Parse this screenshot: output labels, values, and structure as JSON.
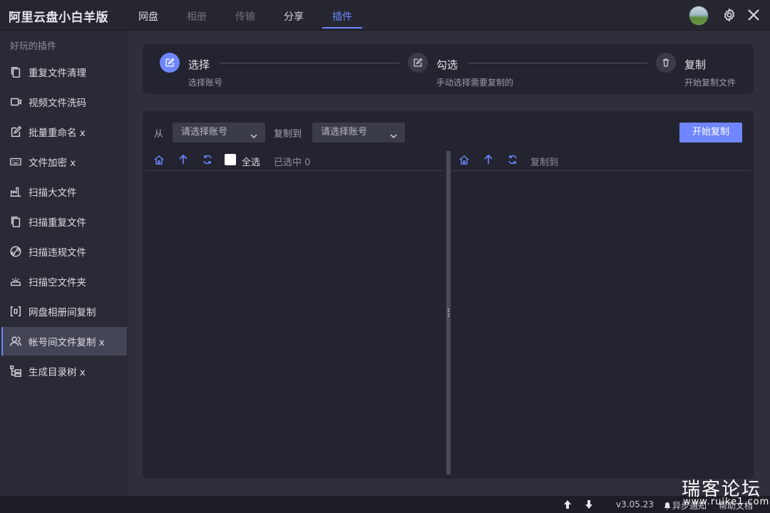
{
  "app": {
    "title": "阿里云盘小白羊版"
  },
  "nav": {
    "tabs": [
      {
        "label": "网盘",
        "state": "normal"
      },
      {
        "label": "相册",
        "state": "dim"
      },
      {
        "label": "传输",
        "state": "dim"
      },
      {
        "label": "分享",
        "state": "normal"
      },
      {
        "label": "插件",
        "state": "active"
      }
    ],
    "icons": [
      "avatar",
      "gear-icon",
      "close-icon"
    ]
  },
  "sidebar": {
    "heading": "好玩的插件",
    "items": [
      {
        "label": "重复文件清理",
        "icon": "duplicate-file-icon"
      },
      {
        "label": "视频文件洗码",
        "icon": "video-icon"
      },
      {
        "label": "批量重命名 x",
        "icon": "rename-icon"
      },
      {
        "label": "文件加密 x",
        "icon": "keyboard-icon"
      },
      {
        "label": "扫描大文件",
        "icon": "factory-icon"
      },
      {
        "label": "扫描重复文件",
        "icon": "copy-icon"
      },
      {
        "label": "扫描违规文件",
        "icon": "link-icon"
      },
      {
        "label": "扫描空文件夹",
        "icon": "sun-cloud-icon"
      },
      {
        "label": "网盘相册间复制",
        "icon": "bracket-icon"
      },
      {
        "label": "帐号间文件复制 x",
        "icon": "users-icon",
        "active": true
      },
      {
        "label": "生成目录树 x",
        "icon": "tree-icon"
      }
    ]
  },
  "steps": [
    {
      "title": "选择",
      "desc": "选择账号",
      "icon": "edit-icon",
      "active": true
    },
    {
      "title": "勾选",
      "desc": "手动选择需要复制的",
      "icon": "edit-icon",
      "active": false
    },
    {
      "title": "复制",
      "desc": "开始复制文件",
      "icon": "trash-icon",
      "active": false
    }
  ],
  "copy_panel": {
    "from_label": "从",
    "from_placeholder": "请选择账号",
    "to_label": "复制到",
    "to_placeholder": "请选择账号",
    "start_button": "开始复制",
    "left_toolbar": {
      "select_all": "全选",
      "selected_count": "已选中 0"
    },
    "right_toolbar": {
      "dest_label": "复制到"
    }
  },
  "statusbar": {
    "version": "v3.05.23",
    "notice": "异步通知",
    "help": "帮助文档"
  },
  "watermark": {
    "text": "瑞客论坛",
    "url": "www.ruike1.com"
  },
  "colors": {
    "accent": "#6f86ff",
    "background": "#2e2f3b",
    "sidebar": "#292a35"
  }
}
